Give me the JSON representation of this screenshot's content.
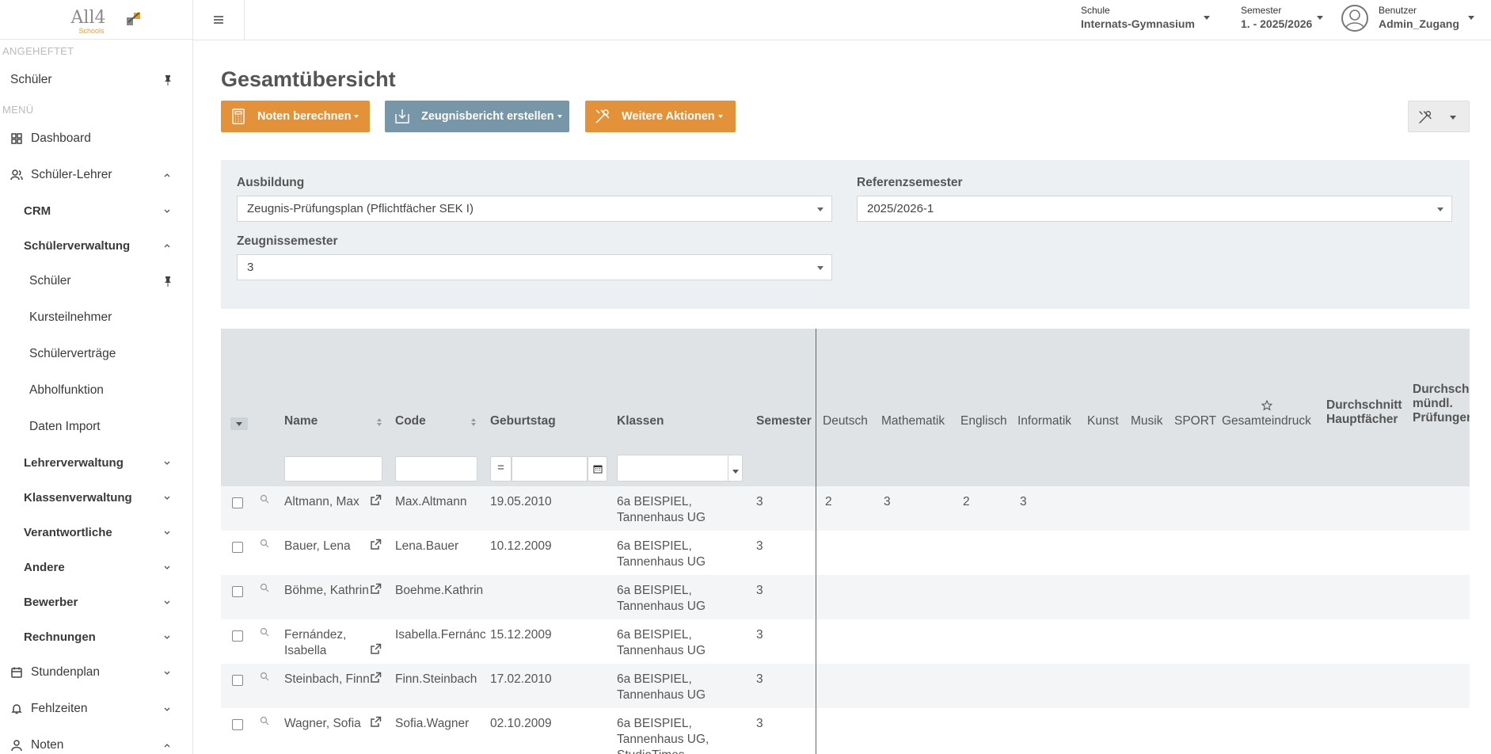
{
  "topbar": {
    "school_label": "Schule",
    "school_value": "Internats-Gymnasium",
    "semester_label": "Semester",
    "semester_value": "1. - 2025/2026",
    "user_label": "Benutzer",
    "user_value": "Admin_Zugang"
  },
  "logo": {
    "text": "All4",
    "sub": "Schools"
  },
  "sidebar": {
    "pinned_header": "ANGEHEFTET",
    "pinned_item": "Schüler",
    "menu_header": "MENÜ",
    "items": [
      {
        "label": "Dashboard",
        "icon": "grid-icon"
      },
      {
        "label": "Schüler-Lehrer",
        "icon": "users-icon"
      },
      {
        "label": "CRM"
      },
      {
        "label": "Schülerverwaltung"
      },
      {
        "label": "Schüler"
      },
      {
        "label": "Kursteilnehmer"
      },
      {
        "label": "Schülerverträge"
      },
      {
        "label": "Abholfunktion"
      },
      {
        "label": "Daten Import"
      },
      {
        "label": "Lehrerverwaltung"
      },
      {
        "label": "Klassenverwaltung"
      },
      {
        "label": "Verantwortliche"
      },
      {
        "label": "Andere"
      },
      {
        "label": "Bewerber"
      },
      {
        "label": "Rechnungen"
      },
      {
        "label": "Stundenplan",
        "icon": "calendar-icon"
      },
      {
        "label": "Fehlzeiten",
        "icon": "bell-icon"
      },
      {
        "label": "Noten",
        "icon": "person-icon"
      }
    ]
  },
  "page": {
    "title": "Gesamtübersicht",
    "btn_noten": "Noten berechnen",
    "btn_zeugnis": "Zeugnisbericht erstellen",
    "btn_weitere": "Weitere Aktionen"
  },
  "filters": {
    "ausbildung_label": "Ausbildung",
    "ausbildung_value": "Zeugnis-Prüfungsplan (Pflichtfächer SEK I)",
    "referenz_label": "Referenzsemester",
    "referenz_value": "2025/2026-1",
    "zeugnis_label": "Zeugnissemester",
    "zeugnis_value": "3"
  },
  "table": {
    "headers": {
      "name": "Name",
      "code": "Code",
      "geburtstag": "Geburtstag",
      "klassen": "Klassen",
      "semester": "Semester",
      "deutsch": "Deutsch",
      "mathematik": "Mathematik",
      "englisch": "Englisch",
      "informatik": "Informatik",
      "kunst": "Kunst",
      "musik": "Musik",
      "sport": "SPORT",
      "gesamteindruck": "Gesamteindruck",
      "durchschnitt_1": "Durchschnitt",
      "durchschnitt_2": "Hauptfächer",
      "muendl_1": "Durchsch",
      "muendl_2": "mündl.",
      "muendl_3": "Prüfungen"
    },
    "date_operator": "=",
    "rows": [
      {
        "name": "Altmann, Max",
        "code": "Max.Altmann",
        "geburtstag": "19.05.2010",
        "klassen_1": "6a BEISPIEL,",
        "klassen_2": "Tannenhaus UG",
        "semester": "3",
        "deutsch": "2",
        "mathematik": "3",
        "englisch": "2",
        "informatik": "3"
      },
      {
        "name": "Bauer, Lena",
        "code": "Lena.Bauer",
        "geburtstag": "10.12.2009",
        "klassen_1": "6a BEISPIEL,",
        "klassen_2": "Tannenhaus UG",
        "semester": "3",
        "deutsch": "",
        "mathematik": "",
        "englisch": "",
        "informatik": ""
      },
      {
        "name": "Böhme, Kathrin",
        "code": "Boehme.Kathrin",
        "geburtstag": "",
        "klassen_1": "6a BEISPIEL,",
        "klassen_2": "Tannenhaus UG",
        "semester": "3",
        "deutsch": "",
        "mathematik": "",
        "englisch": "",
        "informatik": ""
      },
      {
        "name_1": "Fernández,",
        "name_2": "Isabella",
        "code": "Isabella.Fernánc",
        "geburtstag": "15.12.2009",
        "klassen_1": "6a BEISPIEL,",
        "klassen_2": "Tannenhaus UG",
        "semester": "3",
        "deutsch": "",
        "mathematik": "",
        "englisch": "",
        "informatik": ""
      },
      {
        "name": "Steinbach, Finn",
        "code": "Finn.Steinbach",
        "geburtstag": "17.02.2010",
        "klassen_1": "6a BEISPIEL,",
        "klassen_2": "Tannenhaus UG",
        "semester": "3",
        "deutsch": "",
        "mathematik": "",
        "englisch": "",
        "informatik": ""
      },
      {
        "name": "Wagner, Sofia",
        "code": "Sofia.Wagner",
        "geburtstag": "02.10.2009",
        "klassen_1": "6a BEISPIEL,",
        "klassen_2": "Tannenhaus UG,",
        "klassen_3": "StudioTimes",
        "semester": "3",
        "deutsch": "",
        "mathematik": "",
        "englisch": "",
        "informatik": ""
      }
    ]
  },
  "colors": {
    "orange": "#e3923a",
    "slate": "#7796a8",
    "panel": "#edf0f2",
    "header": "#dfe3e6"
  }
}
